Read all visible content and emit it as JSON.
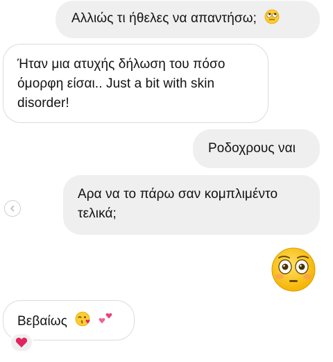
{
  "messages": [
    {
      "id": "m1",
      "direction": "outgoing",
      "text": "Αλλιώς τι ήθελες να απαντήσω;",
      "emoji": "rolling-eyes-face"
    },
    {
      "id": "m2",
      "direction": "incoming",
      "text": "Ήταν μια ατυχής δήλωση του πόσο όμορφη είσαι.. Just a bit with skin disorder!"
    },
    {
      "id": "m3",
      "direction": "outgoing",
      "text": "Ροδοχρους ναι"
    },
    {
      "id": "m4",
      "direction": "outgoing",
      "text": "Αρα να το πάρω σαν κομπλιμέντο τελικά;"
    },
    {
      "id": "m5",
      "direction": "outgoing",
      "emoji_only": "flushed-face"
    },
    {
      "id": "m6",
      "direction": "incoming",
      "text": "Βεβαίως",
      "emojis": [
        "kissing-face-with-heart",
        "two-hearts"
      ],
      "reaction": "red-heart"
    }
  ],
  "colors": {
    "outgoing_bubble": "#efefef",
    "incoming_border": "#dbdbdb",
    "text": "#111111",
    "heart_red": "#e0245e",
    "emoji_yellow": "#ffcc33"
  },
  "icons": {
    "reply_control": "chevron-left-icon"
  }
}
